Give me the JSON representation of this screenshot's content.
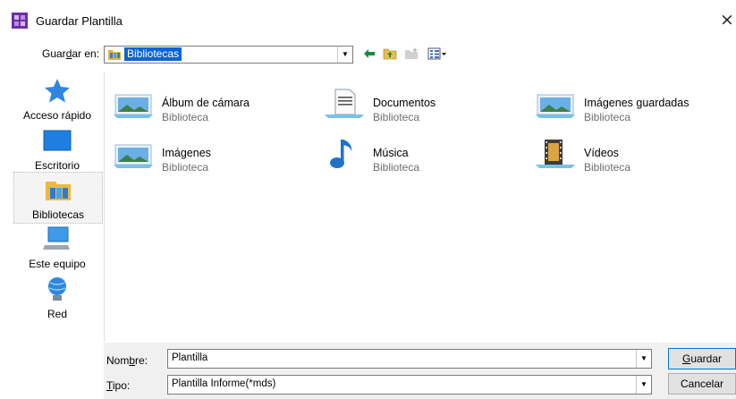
{
  "window": {
    "title": "Guardar Plantilla",
    "close_glyph": "×"
  },
  "save_in": {
    "label_pre": "Guar",
    "label_accel": "d",
    "label_post": "ar en:",
    "value": "Bibliotecas",
    "folder_icon": "libraries-folder-icon"
  },
  "toolbar": [
    "back-arrow-icon",
    "up-folder-icon",
    "new-folder-icon",
    "view-menu-icon"
  ],
  "places": [
    {
      "label": "Acceso rápido",
      "icon": "star-icon"
    },
    {
      "label": "Escritorio",
      "icon": "desktop-icon"
    },
    {
      "label": "Bibliotecas",
      "icon": "libraries-icon",
      "selected": true
    },
    {
      "label": "Este equipo",
      "icon": "computer-icon"
    },
    {
      "label": "Red",
      "icon": "network-icon"
    }
  ],
  "items": [
    {
      "name": "Álbum de cámara",
      "type": "Biblioteca",
      "icon": "picture-library-icon"
    },
    {
      "name": "Documentos",
      "type": "Biblioteca",
      "icon": "document-library-icon"
    },
    {
      "name": "Imágenes guardadas",
      "type": "Biblioteca",
      "icon": "picture-library-icon"
    },
    {
      "name": "Imágenes",
      "type": "Biblioteca",
      "icon": "picture-library-icon"
    },
    {
      "name": "Música",
      "type": "Biblioteca",
      "icon": "music-note-icon"
    },
    {
      "name": "Vídeos",
      "type": "Biblioteca",
      "icon": "video-filmstrip-icon"
    }
  ],
  "name_field": {
    "label_pre": "Nom",
    "label_accel": "b",
    "label_post": "re:",
    "value": "Plantilla"
  },
  "type_field": {
    "label_accel": "T",
    "label_post": "ipo:",
    "value": "Plantilla Informe(*mds)"
  },
  "buttons": {
    "save_accel": "G",
    "save_rest": "uardar",
    "cancel": "Cancelar"
  },
  "colors": {
    "selection": "#0a64d8",
    "accent": "#0078d7"
  }
}
